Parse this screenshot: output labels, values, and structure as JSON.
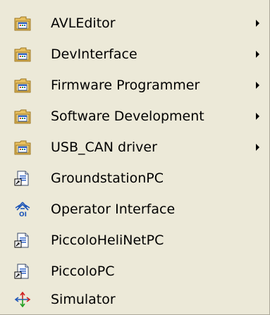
{
  "menu": {
    "items": [
      {
        "label": "AVLEditor",
        "icon": "program-group-folder-icon",
        "submenu": true
      },
      {
        "label": "DevInterface",
        "icon": "program-group-folder-icon",
        "submenu": true
      },
      {
        "label": "Firmware Programmer",
        "icon": "program-group-folder-icon",
        "submenu": true
      },
      {
        "label": "Software Development",
        "icon": "program-group-folder-icon",
        "submenu": true
      },
      {
        "label": "USB_CAN driver",
        "icon": "program-group-folder-icon",
        "submenu": true
      },
      {
        "label": "GroundstationPC",
        "icon": "shortcut-document-icon",
        "submenu": false
      },
      {
        "label": "Operator Interface",
        "icon": "operator-interface-app-icon",
        "submenu": false
      },
      {
        "label": "PiccoloHeliNetPC",
        "icon": "shortcut-document-icon",
        "submenu": false
      },
      {
        "label": "PiccoloPC",
        "icon": "shortcut-document-icon",
        "submenu": false
      },
      {
        "label": "Simulator",
        "icon": "simulator-app-icon",
        "submenu": false
      }
    ]
  }
}
